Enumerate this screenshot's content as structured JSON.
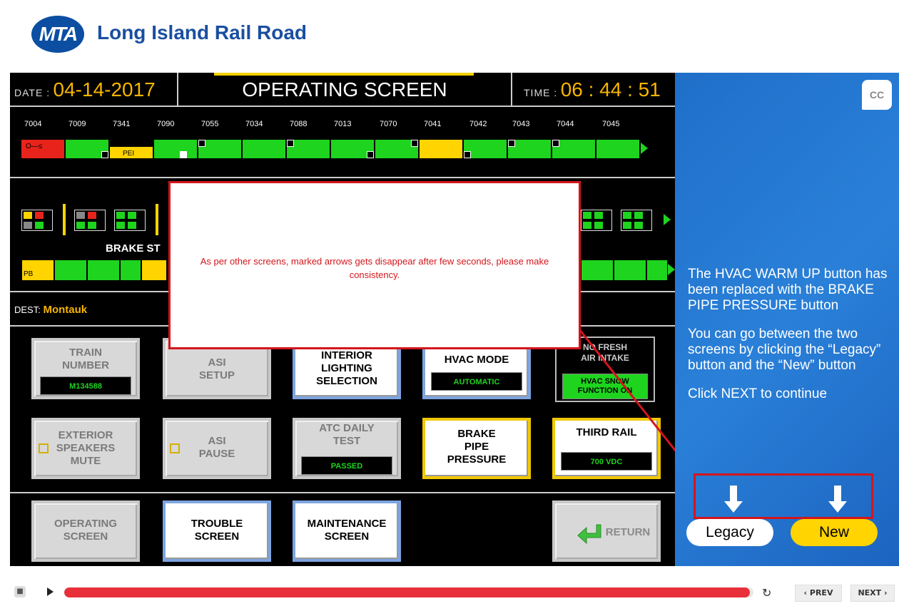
{
  "header": {
    "logo_text": "MTA",
    "title": "Long Island Rail Road"
  },
  "screen": {
    "date_label": "DATE :",
    "date_value": "04-14-2017",
    "title": "OPERATING SCREEN",
    "time_label": "TIME :",
    "time_value": "06 : 44 : 51",
    "cars": [
      "7004",
      "7009",
      "7341",
      "7090",
      "7055",
      "7034",
      "7088",
      "7013",
      "7070",
      "7041",
      "7042",
      "7043",
      "7044",
      "7045"
    ],
    "car_tags": {
      "pei": "PEI",
      "pb": "PB"
    },
    "brake_label": "BRAKE ST",
    "dest_label": "DEST:",
    "dest_value": "Montauk",
    "buttons": {
      "train_number": "TRAIN NUMBER",
      "train_number_value": "M134588",
      "asi_setup": "ASI SETUP",
      "interior_lighting": "INTERIOR LIGHTING SELECTION",
      "hvac_mode": "HVAC MODE",
      "hvac_mode_value": "AUTOMATIC",
      "no_fresh_air": "NO FRESH AIR INTAKE",
      "hvac_snow": "HVAC SNOW FUNCTION ON",
      "exterior_speakers": "EXTERIOR SPEAKERS MUTE",
      "asi_pause": "ASI PAUSE",
      "atc_daily_test": "ATC DAILY TEST",
      "atc_value": "PASSED",
      "brake_pipe": "BRAKE PIPE PRESSURE",
      "third_rail": "THIRD RAIL",
      "third_rail_value": "700 VDC",
      "operating_screen": "OPERATING SCREEN",
      "trouble_screen": "TROUBLE SCREEN",
      "maintenance_screen": "MAINTENANCE SCREEN",
      "return": "RETURN"
    }
  },
  "popup": {
    "text": "As per other screens, marked arrows gets disappear after few seconds, please make consistency."
  },
  "panel": {
    "cc": "CC",
    "p1": "The HVAC WARM UP button has been replaced with the BRAKE PIPE PRESSURE button",
    "p2": "You can go between the two screens by clicking the “Legacy” button and the “New” button",
    "p3": "Click NEXT to continue",
    "legacy": "Legacy",
    "new": "New"
  },
  "player": {
    "prev": "‹ PREV",
    "next": "NEXT ›",
    "progress": 0.995
  },
  "colors": {
    "brand": "#1a4fa0",
    "green": "#1ed41e",
    "yellow": "#ffd400",
    "red": "#e8231b",
    "progress": "#e8303b",
    "panel": "#2a80d8"
  }
}
